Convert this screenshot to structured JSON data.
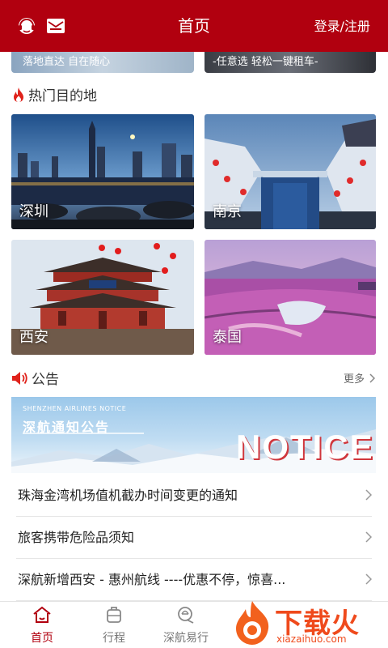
{
  "header": {
    "title": "首页",
    "login_label": "登录/注册",
    "left_icons": [
      "customer-service-icon",
      "mail-icon"
    ],
    "bg_color": "#b1000f"
  },
  "promos": [
    {
      "text": "落地直达 自在随心"
    },
    {
      "text": "-任意选 轻松一键租车-"
    }
  ],
  "hot_section": {
    "title": "热门目的地",
    "icon": "flame-icon",
    "destinations": [
      {
        "name": "深圳"
      },
      {
        "name": "南京"
      },
      {
        "name": "西安"
      },
      {
        "name": "泰国"
      }
    ]
  },
  "notice_section": {
    "title": "公告",
    "icon": "speaker-icon",
    "more_label": "更多",
    "banner": {
      "subtitle": "SHENZHEN AIRLINES NOTICE",
      "title": "深航通知公告",
      "word": "NOTICE"
    },
    "items": [
      {
        "text": "珠海金湾机场值机截办时间变更的通知"
      },
      {
        "text": "旅客携带危险品须知"
      },
      {
        "text": "深航新增西安 - 惠州航线 ----优惠不停，惊喜..."
      }
    ]
  },
  "tabbar": {
    "tabs": [
      {
        "label": "首页",
        "icon": "home-icon",
        "active": true
      },
      {
        "label": "行程",
        "icon": "luggage-icon",
        "active": false
      },
      {
        "label": "深航易行",
        "icon": "easy-travel-icon",
        "active": false
      }
    ],
    "active_color": "#b1000f"
  },
  "watermark": {
    "big": "下载火",
    "small": "xiazaihuo.com"
  }
}
